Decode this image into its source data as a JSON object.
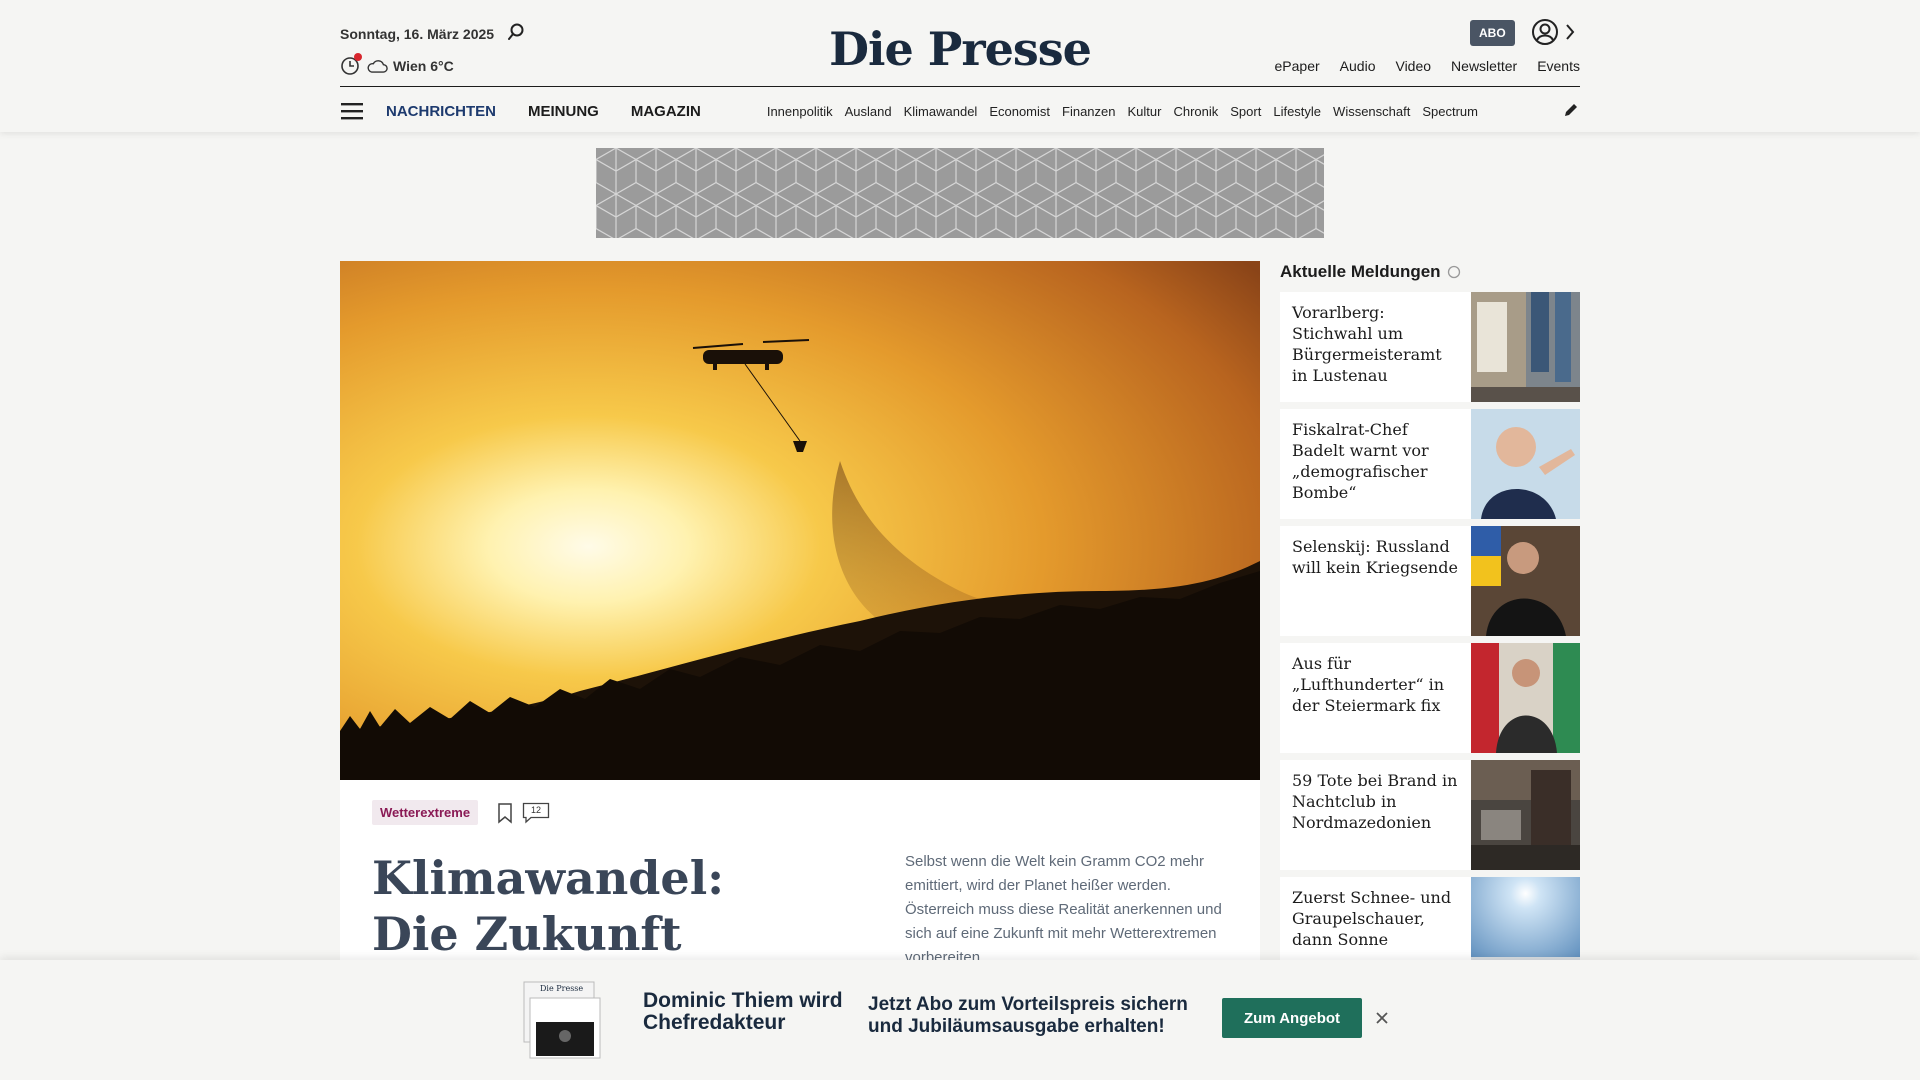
{
  "header": {
    "date": "Sonntag, 16. März 2025",
    "weather": "Wien 6°C",
    "logo": "Die Presse",
    "abo_label": "ABO",
    "top_links": [
      "ePaper",
      "Audio",
      "Video",
      "Newsletter",
      "Events"
    ]
  },
  "nav": {
    "main": [
      "NACHRICHTEN",
      "MEINUNG",
      "MAGAZIN"
    ],
    "sections": [
      "Innenpolitik",
      "Ausland",
      "Klimawandel",
      "Economist",
      "Finanzen",
      "Kultur",
      "Chronik",
      "Sport",
      "Lifestyle",
      "Wissenschaft",
      "Spectrum"
    ]
  },
  "hero_article": {
    "tag": "Wetterextreme",
    "comment_count": "12",
    "headline": "Klimawandel: Die Zukunft gehört",
    "lead": "Selbst wenn die Welt kein Gramm CO2 mehr emittiert, wird der Planet heißer werden. Österreich muss diese Realität anerkennen und sich auf eine Zukunft mit mehr Wetterextremen vorbereiten."
  },
  "sidebar": {
    "title": "Aktuelle Meldungen",
    "items": [
      {
        "title": "Vorarlberg: Stichwahl um Bürgermeisteramt in Lustenau"
      },
      {
        "title": "Fiskalrat-Chef Badelt warnt vor „demografischer Bombe“"
      },
      {
        "title": "Selenskij: Russland will kein Kriegsende"
      },
      {
        "title": "Aus für „Lufthunderter“ in der Steiermark fix"
      },
      {
        "title": "59 Tote bei Brand in Nachtclub in Nordmazedonien"
      },
      {
        "title": "Zuerst Schnee- und Graupelschauer, dann Sonne"
      }
    ]
  },
  "banner": {
    "title": "Dominic Thiem wird Chefredakteur",
    "offer": "Jetzt Abo zum Vorteilspreis sichern und Jubiläumsausgabe erhalten!",
    "button": "Zum Angebot",
    "paper_logo": "Die Presse"
  },
  "colors": {
    "accent_nav": "#1d3a6e",
    "tag_text": "#8a1a55",
    "cta_button": "#1f6f5b",
    "abo_badge": "#4a5564",
    "notification_dot": "#d7262d"
  }
}
